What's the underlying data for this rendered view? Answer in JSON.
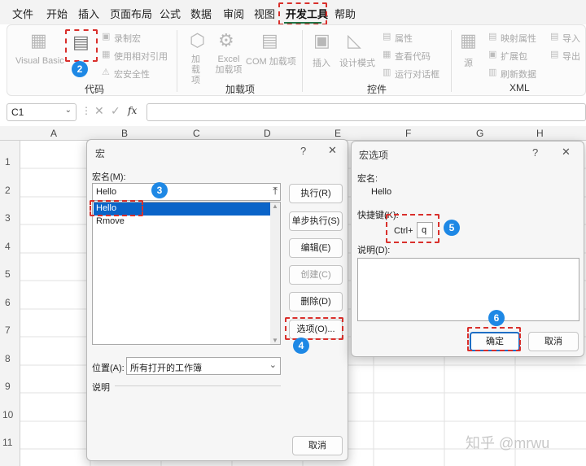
{
  "menu": {
    "items": [
      "文件",
      "开始",
      "插入",
      "页面布局",
      "公式",
      "数据",
      "审阅",
      "视图",
      "开发工具",
      "帮助"
    ],
    "active": "开发工具"
  },
  "ribbon": {
    "code_group": {
      "title": "代码",
      "visual_basic": "Visual Basic",
      "macros": "宏",
      "record_macro": "录制宏",
      "relative_ref": "使用相对引用",
      "macro_security": "宏安全性"
    },
    "addins_group": {
      "title": "加载项",
      "addins": "加载项",
      "excel_addins": "Excel 加载项",
      "com_addins": "COM 加载项"
    },
    "controls_group": {
      "title": "控件",
      "insert": "插入",
      "design_mode": "设计模式",
      "properties": "属性",
      "view_code": "查看代码",
      "run_dialog": "运行对话框"
    },
    "xml_group": {
      "title": "XML",
      "source": "源",
      "map_props": "映射属性",
      "expansion": "扩展包",
      "refresh": "刷新数据",
      "import": "导入",
      "export": "导出"
    }
  },
  "formula_bar": {
    "name_box": "C1",
    "fx": "fx"
  },
  "grid": {
    "columns": [
      "A",
      "B",
      "C",
      "D",
      "E",
      "F",
      "G",
      "H"
    ],
    "rows": [
      "1",
      "2",
      "3",
      "4",
      "5",
      "6",
      "7",
      "8",
      "9",
      "10",
      "11"
    ]
  },
  "macro_dialog": {
    "title": "宏",
    "name_label": "宏名(M):",
    "name_value": "Hello",
    "list": [
      "Hello",
      "Rmove"
    ],
    "selected": "Hello",
    "buttons": {
      "run": "执行(R)",
      "step": "单步执行(S)",
      "edit": "编辑(E)",
      "create": "创建(C)",
      "delete": "删除(D)",
      "options": "选项(O)...",
      "cancel": "取消"
    },
    "location_label": "位置(A):",
    "location_value": "所有打开的工作簿",
    "desc_label": "说明"
  },
  "options_dialog": {
    "title": "宏选项",
    "name_label": "宏名:",
    "name_value": "Hello",
    "shortcut_label": "快捷键(K):",
    "ctrl_prefix": "Ctrl+",
    "shortcut_key": "q",
    "desc_label": "说明(D):",
    "ok": "确定",
    "cancel": "取消"
  },
  "badges": [
    "1",
    "2",
    "3",
    "4",
    "5",
    "6"
  ],
  "watermark": "知乎 @mrwu",
  "colors": {
    "accent": "#1e88e5",
    "annotation": "#d9302c",
    "selection": "#0a64c8",
    "excel_green": "#217346"
  }
}
